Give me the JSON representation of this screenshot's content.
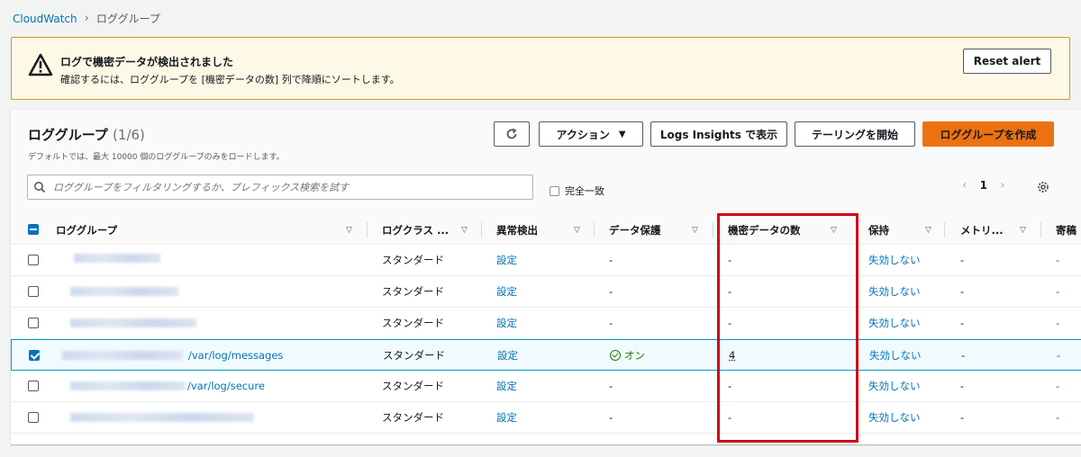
{
  "breadcrumb": {
    "root": "CloudWatch",
    "current": "ロググループ"
  },
  "alert": {
    "title": "ログで機密データが検出されました",
    "message": "確認するには、ロググループを [機密データの数] 列で降順にソートします。",
    "reset_label": "Reset alert"
  },
  "panel": {
    "title": "ロググループ",
    "count": "(1/6)",
    "description": "デフォルトでは、最大 10000 個のロググループのみをロードします。",
    "actions_label": "アクション",
    "insights_label": "Logs Insights で表示",
    "tailing_label": "テーリングを開始",
    "create_label": "ロググループを作成",
    "search_placeholder": "ロググループをフィルタリングするか、プレフィックス検索を試す",
    "exact_match_label": "完全一致",
    "page": "1"
  },
  "columns": {
    "log_group": "ロググループ",
    "log_class": "ログクラス ...",
    "anomaly": "異常検出",
    "protection": "データ保護",
    "sensitive": "機密データの数",
    "retention": "保持",
    "metrics": "メトリ...",
    "contrib": "寄稿"
  },
  "rows": [
    {
      "name": "",
      "log_class": "スタンダード",
      "anomaly": "設定",
      "protection": "-",
      "sensitive": "-",
      "retention": "失効しない",
      "metrics": "-",
      "contrib": "-"
    },
    {
      "name": "",
      "log_class": "スタンダード",
      "anomaly": "設定",
      "protection": "-",
      "sensitive": "-",
      "retention": "失効しない",
      "metrics": "-",
      "contrib": "-"
    },
    {
      "name": "",
      "log_class": "スタンダード",
      "anomaly": "設定",
      "protection": "-",
      "sensitive": "-",
      "retention": "失効しない",
      "metrics": "-",
      "contrib": "-"
    },
    {
      "name": "/var/log/messages",
      "log_class": "スタンダード",
      "anomaly": "設定",
      "protection": "オン",
      "sensitive": "4",
      "retention": "失効しない",
      "metrics": "-",
      "contrib": "-",
      "selected": true
    },
    {
      "name": "/var/log/secure",
      "log_class": "スタンダード",
      "anomaly": "設定",
      "protection": "-",
      "sensitive": "-",
      "retention": "失効しない",
      "metrics": "-",
      "contrib": "-"
    },
    {
      "name": "",
      "log_class": "スタンダード",
      "anomaly": "設定",
      "protection": "-",
      "sensitive": "-",
      "retention": "失効しない",
      "metrics": "-",
      "contrib": "-"
    }
  ],
  "colors": {
    "link": "#0073bb",
    "primary": "#ec7211",
    "warning_border": "#d09a20",
    "highlight": "#d0021b",
    "success": "#1d8102"
  }
}
